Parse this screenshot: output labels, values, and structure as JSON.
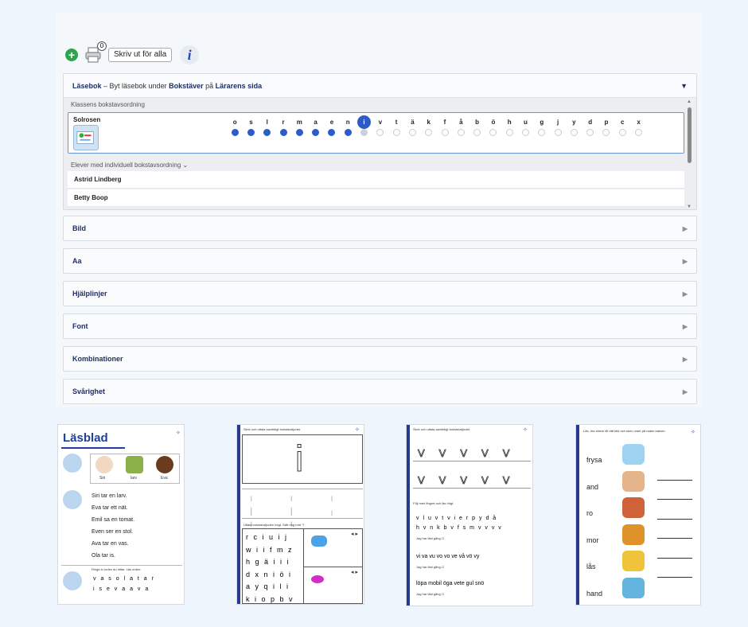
{
  "toolbar": {
    "print_badge": "0",
    "print_all_label": "Skriv ut för alla",
    "info_label": "i"
  },
  "reader": {
    "title": "Läsebok",
    "subtitle_pre": " – Byt läsebok under ",
    "subtitle_b1": "Bokstäver",
    "subtitle_mid": " på ",
    "subtitle_b2": "Lärarens sida",
    "class_order_label": "Klassens bokstavsordning",
    "class_name": "Solrosen",
    "letters": [
      "o",
      "s",
      "l",
      "r",
      "m",
      "a",
      "e",
      "n",
      "i",
      "v",
      "t",
      "ä",
      "k",
      "f",
      "å",
      "b",
      "ö",
      "h",
      "u",
      "g",
      "j",
      "y",
      "d",
      "p",
      "c",
      "x"
    ],
    "done_count": 8,
    "current_index": 8,
    "individual_label": "Elever med individuell bokstavsordning",
    "students": [
      "Astrid Lindberg",
      "Betty Boop"
    ]
  },
  "sections": [
    "Bild",
    "Aa",
    "Hjälplinjer",
    "Font",
    "Kombinationer",
    "Svårighet"
  ],
  "sheet1": {
    "title": "Läsblad",
    "names": [
      "Siri",
      "larv",
      "Eva"
    ],
    "sentences": [
      "Siri tar en larv.",
      "Eva tar ett nät.",
      "Emil sa en tomat.",
      "Even ser en stol.",
      "Ava tar en vas.",
      "Ola tar is."
    ],
    "footer_note": "Ringa in orden du hittar. Läs orden.",
    "row1": "v a s o l a t a r",
    "row2": "i s e v a a v a"
  },
  "sheet2": {
    "header": "Skriv och uttala samtidigt bokstavsljudet.",
    "letter": "i",
    "mid_note": "Uttala bokstavsljuden högt. Sätt ring runt \"i\".",
    "grid": [
      "r c i u i j",
      "w i i f m z",
      "h g ä i i i",
      "d x n i ö i",
      "a y q i l i",
      "k i o p b v"
    ]
  },
  "sheet3": {
    "header": "Skriv och uttala samtidigt bokstavsljudet.",
    "letter": "V",
    "follow_note": "Följ med fingret och läs högt.",
    "line1a": "v l u v t v i e r p y d å",
    "line1b": "h v n k b v f s m v v v v",
    "read_note": "Jag har läst   gång",
    "line2": "vi  va  vu  vo  vo  ve  vå  vö  vy",
    "line3": "löpa  mobil  öga  vete  gul  snö"
  },
  "sheet4": {
    "header": "Läs, dra streck till rätt bild och skriv ordet på raden bakom.",
    "words": [
      "frysa",
      "and",
      "ro",
      "mor",
      "lås",
      "hand"
    ]
  }
}
